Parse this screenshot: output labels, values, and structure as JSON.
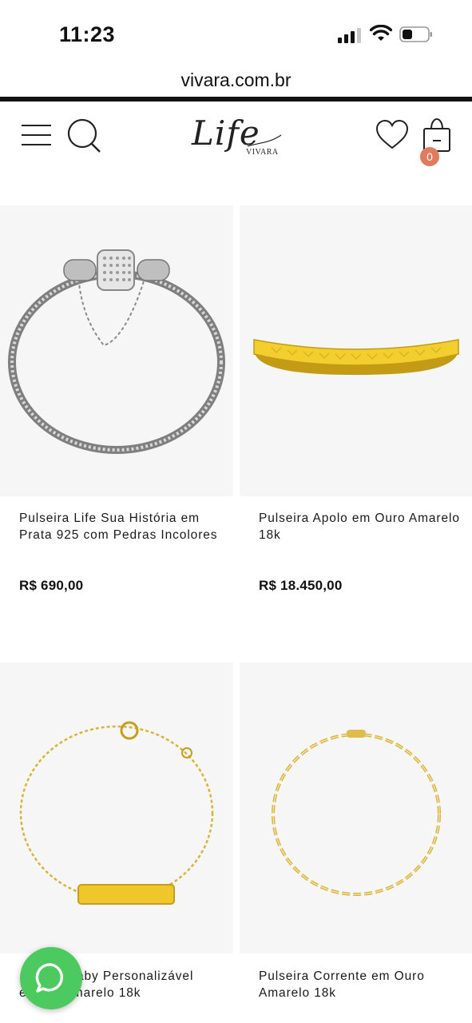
{
  "status_bar": {
    "time": "11:23",
    "signal_icon": "cellular-signal-icon",
    "wifi_icon": "wifi-icon",
    "battery_icon": "battery-icon"
  },
  "browser": {
    "url": "vivara.com.br"
  },
  "header": {
    "menu_icon": "hamburger-menu-icon",
    "search_icon": "search-icon",
    "logo_script": "Life",
    "logo_brand": "VIVARA",
    "wishlist_icon": "heart-icon",
    "bag_icon": "shopping-bag-icon",
    "bag_count": "0",
    "badge_color": "#e07b5f"
  },
  "products": [
    {
      "name": "Pulseira Life Sua História em Prata 925 com Pedras Incolores",
      "price": "R$ 690,00"
    },
    {
      "name": "Pulseira Apolo em Ouro Amarelo 18k",
      "price": "R$ 18.450,00"
    },
    {
      "name": "aby Personalizável",
      "name_line2": "e         Amarelo 18k"
    },
    {
      "name": "Pulseira Corrente em Ouro Amarelo 18k"
    }
  ],
  "fab": {
    "icon": "whatsapp-chat-icon",
    "color": "#4cc95f"
  }
}
